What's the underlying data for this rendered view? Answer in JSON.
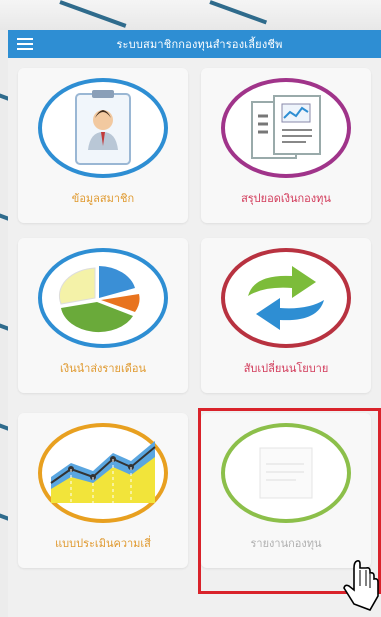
{
  "header": {
    "title": "ระบบสมาชิกกองทุนสำรองเลี้ยงชีพ",
    "menu_icon": "hamburger-menu-icon"
  },
  "tiles": [
    {
      "label": "ข้อมูลสมาชิก",
      "icon": "member-clipboard-icon"
    },
    {
      "label": "สรุปยอดเงินกองทุน",
      "icon": "fund-summary-document-icon"
    },
    {
      "label": "เงินนำส่งรายเดือน",
      "icon": "monthly-pie-chart-icon"
    },
    {
      "label": "สับเปลี่ยนนโยบาย",
      "icon": "switch-policy-arrows-icon"
    },
    {
      "label": "แบบประเมินความเสี่",
      "icon": "risk-assessment-chart-icon"
    },
    {
      "label": "รายงานกองทุน",
      "icon": "fund-report-icon"
    }
  ],
  "colors": {
    "header_bg": "#2e8ed3",
    "highlight_border": "#d9222a"
  }
}
